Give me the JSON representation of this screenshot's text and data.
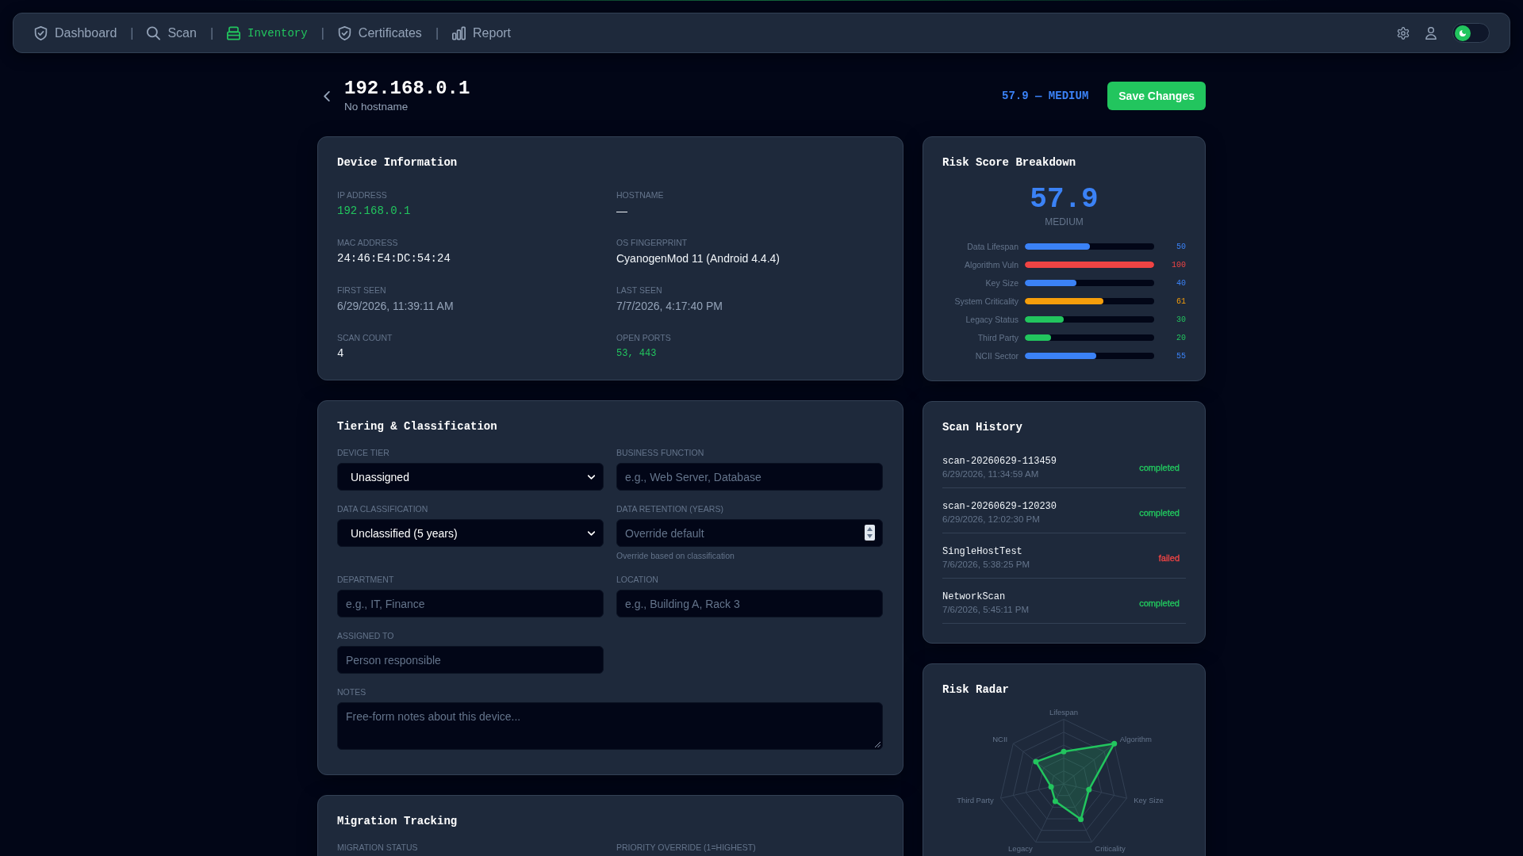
{
  "nav": {
    "items": [
      {
        "label": "Dashboard",
        "selected": false
      },
      {
        "label": "Scan",
        "selected": false
      },
      {
        "label": "Inventory",
        "selected": true
      },
      {
        "label": "Certificates",
        "selected": false
      },
      {
        "label": "Report",
        "selected": false
      }
    ],
    "separators": [
      "|",
      "|",
      "|",
      "|"
    ],
    "theme_toggle": {
      "on": false
    }
  },
  "header": {
    "title": "192.168.0.1",
    "subtitle": "No hostname",
    "risk_summary": "57.9 — MEDIUM",
    "save_button": "Save Changes"
  },
  "device_information": {
    "title": "Device Information",
    "fields": [
      {
        "label": "IP ADDRESS",
        "value": "192.168.0.1",
        "kind": "address"
      },
      {
        "label": "HOSTNAME",
        "value": "—",
        "kind": "text"
      },
      {
        "label": "MAC ADDRESS",
        "value": "24:46:E4:DC:54:24",
        "kind": "identifier"
      },
      {
        "label": "OS FINGERPRINT",
        "value": "CyanogenMod 11 (Android 4.4.4)",
        "kind": "text"
      },
      {
        "label": "FIRST SEEN",
        "value": "6/29/2026, 11:39:11 AM",
        "kind": "timestamp"
      },
      {
        "label": "LAST SEEN",
        "value": "7/7/2026, 4:17:40 PM",
        "kind": "timestamp"
      },
      {
        "label": "SCAN COUNT",
        "value": "4",
        "kind": "identifier"
      },
      {
        "label": "OPEN PORTS",
        "value": "53, 443",
        "kind": "ports"
      }
    ]
  },
  "tiering": {
    "title": "Tiering & Classification",
    "fields": [
      {
        "label": "DEVICE TIER",
        "kind": "select",
        "value": "Unassigned"
      },
      {
        "label": "BUSINESS FUNCTION",
        "kind": "input",
        "placeholder": "e.g., Web Server, Database"
      },
      {
        "label": "DATA CLASSIFICATION",
        "kind": "select",
        "value": "Unclassified (5 years)"
      },
      {
        "label": "DATA RETENTION (YEARS)",
        "kind": "number",
        "placeholder": "Override default",
        "hint": "Override based on classification"
      },
      {
        "label": "DEPARTMENT",
        "kind": "input",
        "placeholder": "e.g., IT, Finance"
      },
      {
        "label": "LOCATION",
        "kind": "input",
        "placeholder": "e.g., Building A, Rack 3"
      },
      {
        "label": "ASSIGNED TO",
        "kind": "input",
        "placeholder": "Person responsible"
      },
      {
        "label": "NOTES",
        "kind": "textarea",
        "placeholder": "Free-form notes about this device..."
      }
    ]
  },
  "migration_tracking": {
    "title": "Migration Tracking",
    "fields": [
      {
        "label": "MIGRATION STATUS"
      },
      {
        "label": "PRIORITY OVERRIDE (1=HIGHEST)"
      }
    ]
  },
  "risk_breakdown": {
    "title": "Risk Score Breakdown",
    "score": "57.9",
    "level_label": "MEDIUM",
    "factors": [
      {
        "label": "Data Lifespan",
        "level": 0.5,
        "value": "50",
        "color": "#3b82f6"
      },
      {
        "label": "Algorithm Vuln",
        "level": 1.0,
        "value": "100",
        "color": "#ef4444"
      },
      {
        "label": "Key Size",
        "level": 0.4,
        "value": "40",
        "color": "#3b82f6"
      },
      {
        "label": "System Criticality",
        "level": 0.61,
        "value": "61",
        "color": "#f59e0b"
      },
      {
        "label": "Legacy Status",
        "level": 0.3,
        "value": "30",
        "color": "#22c55e"
      },
      {
        "label": "Third Party",
        "level": 0.2,
        "value": "20",
        "color": "#22c55e"
      },
      {
        "label": "NCII Sector",
        "level": 0.55,
        "value": "55",
        "color": "#3b82f6"
      }
    ]
  },
  "scan_history": {
    "title": "Scan History",
    "scans": [
      {
        "name": "scan-20260629-113459",
        "time": "6/29/2026, 11:34:59 AM",
        "status": "completed",
        "color": "#22c55e"
      },
      {
        "name": "scan-20260629-120230",
        "time": "6/29/2026, 12:02:30 PM",
        "status": "completed",
        "color": "#22c55e"
      },
      {
        "name": "SingleHostTest",
        "time": "7/6/2026, 5:38:25 PM",
        "status": "failed",
        "color": "#ef4444"
      },
      {
        "name": "NetworkScan",
        "time": "7/6/2026, 5:45:11 PM",
        "status": "completed",
        "color": "#22c55e"
      }
    ]
  },
  "risk_radar": {
    "title": "Risk Radar",
    "axes": [
      "Lifespan",
      "Algorithm",
      "Key Size",
      "Criticality",
      "Legacy",
      "Third Party",
      "NCII"
    ]
  }
}
